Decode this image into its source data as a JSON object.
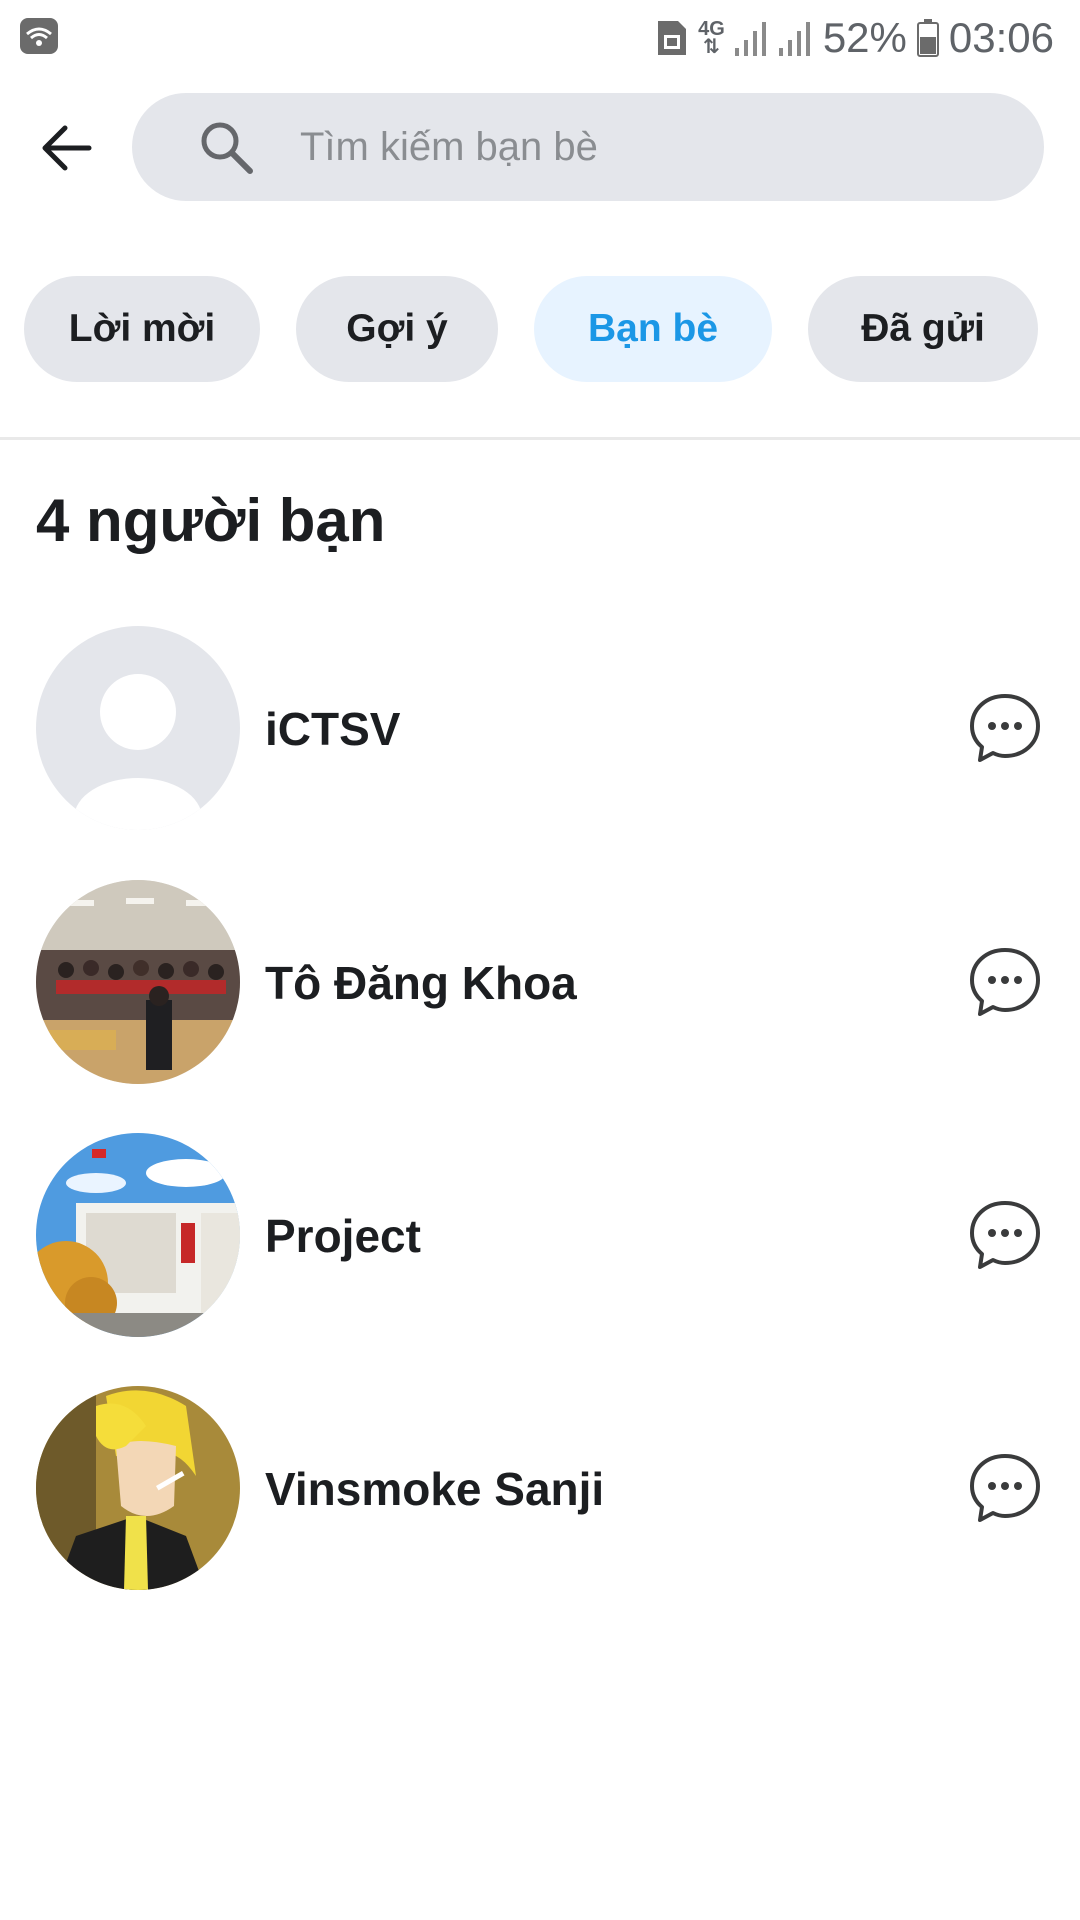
{
  "status_bar": {
    "battery_percent": "52%",
    "time": "03:06",
    "network": "4G",
    "icons": [
      "wifi-icon",
      "sim-icon",
      "signal-icon",
      "battery-icon"
    ]
  },
  "header": {
    "back_icon": "arrow-left-icon",
    "search_icon": "search-icon",
    "search_placeholder": "Tìm kiếm bạn bè"
  },
  "tabs": [
    {
      "label": "Lời mời",
      "active": false
    },
    {
      "label": "Gợi ý",
      "active": false
    },
    {
      "label": "Bạn bè",
      "active": true
    },
    {
      "label": "Đã gửi",
      "active": false
    }
  ],
  "friends_count_label": "4 người bạn",
  "friends": [
    {
      "name": "iCTSV",
      "avatar": "default-avatar",
      "action_icon": "message-icon"
    },
    {
      "name": "Tô Đăng Khoa",
      "avatar": "classroom-photo-avatar",
      "action_icon": "message-icon"
    },
    {
      "name": "Project",
      "avatar": "building-photo-avatar",
      "action_icon": "message-icon"
    },
    {
      "name": "Vinsmoke Sanji",
      "avatar": "anime-character-avatar",
      "action_icon": "message-icon"
    }
  ],
  "colors": {
    "accent": "#1b97e6",
    "active_tab_bg": "#e7f3ff",
    "chip_bg": "#e4e6eb",
    "text": "#1c1e21"
  }
}
